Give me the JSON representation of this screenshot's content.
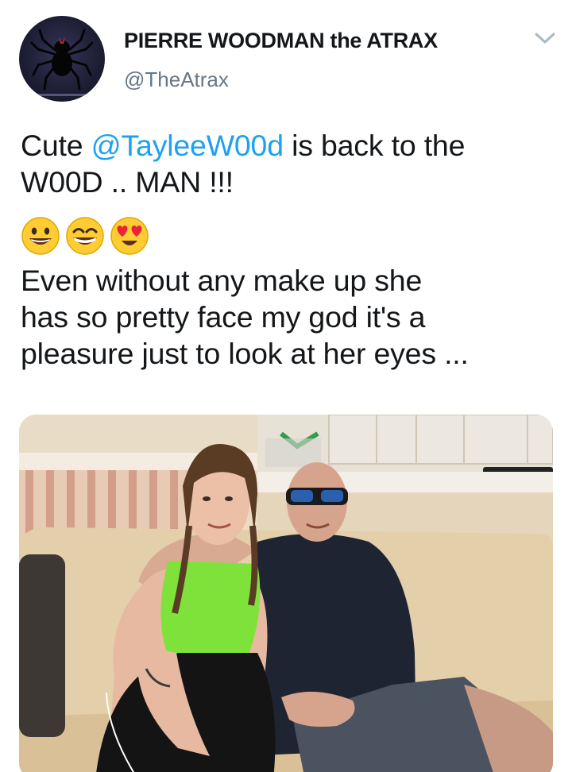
{
  "author": {
    "display_name": "PIERRE WOODMAN the ATRAX",
    "handle": "@TheAtrax",
    "avatar_icon": "spider-logo-icon"
  },
  "tweet": {
    "line1_prefix": "Cute ",
    "mention": "@TayleeW00d",
    "line1_suffix": " is back to the",
    "line2": "W00D .. MAN !!!",
    "emojis": [
      "grinning-face-icon",
      "beaming-face-icon",
      "heart-eyes-face-icon"
    ],
    "line3": "Even without any make up she",
    "line4": "has so pretty face my god it's a",
    "line5": "pleasure just to look at her eyes ..."
  },
  "menu": {
    "icon": "chevron-down-icon"
  },
  "colors": {
    "mention": "#1da1f2",
    "handle": "#657786",
    "text": "#14171a"
  }
}
